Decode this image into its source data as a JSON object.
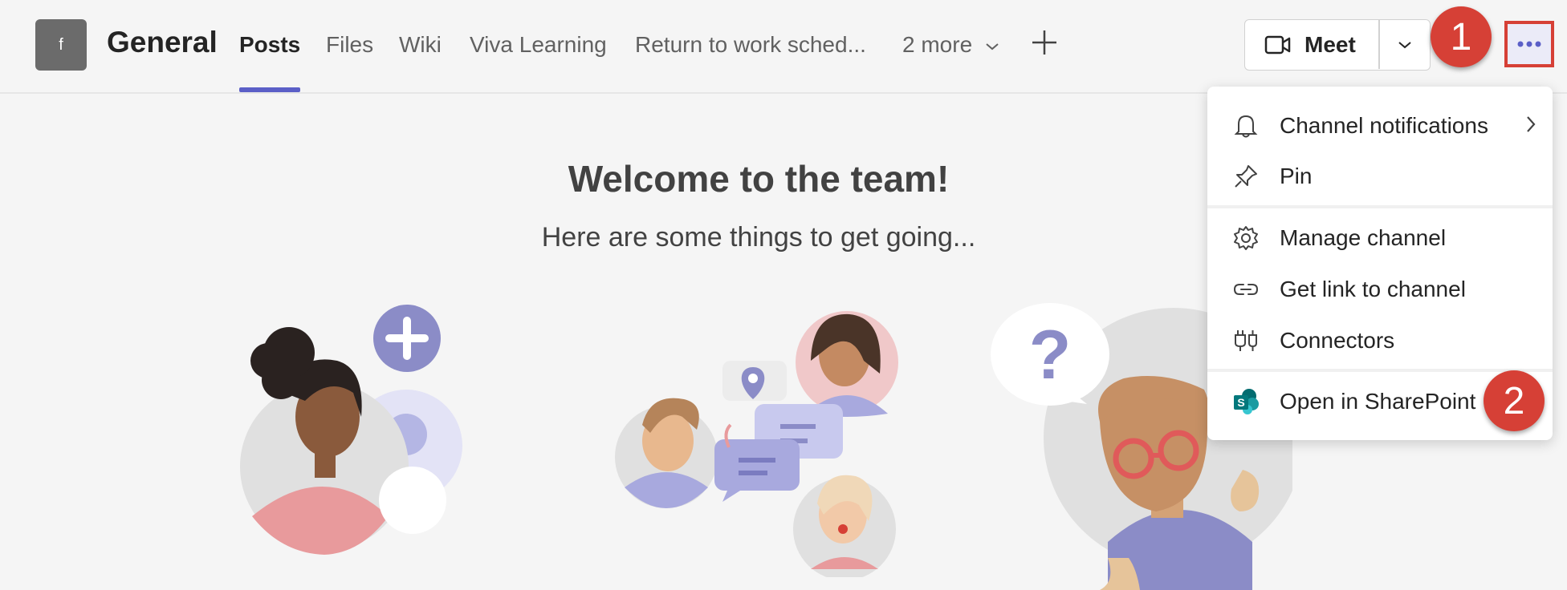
{
  "header": {
    "team_initial": "f",
    "channel_name": "General",
    "tabs": [
      {
        "label": "Posts",
        "active": true
      },
      {
        "label": "Files"
      },
      {
        "label": "Wiki"
      },
      {
        "label": "Viva Learning"
      },
      {
        "label": "Return to work sched..."
      },
      {
        "label": "2 more"
      }
    ],
    "add_tab_icon": "plus-icon",
    "meet": {
      "label": "Meet",
      "icon": "video-camera-icon",
      "dropdown_icon": "chevron-down-icon"
    },
    "more_options_icon": "ellipsis-icon"
  },
  "annotations": {
    "badge_1": "1",
    "badge_2": "2",
    "color": "#d64036"
  },
  "main": {
    "title": "Welcome to the team!",
    "subtitle": "Here are some things to get going..."
  },
  "menu": {
    "items": [
      {
        "label": "Channel notifications",
        "icon": "bell-icon",
        "has_submenu": true
      },
      {
        "label": "Pin",
        "icon": "pin-icon"
      },
      {
        "label": "Manage channel",
        "icon": "gear-icon"
      },
      {
        "label": "Get link to channel",
        "icon": "link-icon"
      },
      {
        "label": "Connectors",
        "icon": "connector-plug-icon"
      },
      {
        "label": "Open in SharePoint",
        "icon": "sharepoint-icon"
      }
    ]
  },
  "colors": {
    "accent": "#5b5fc7",
    "background": "#f5f5f5",
    "annotation_red": "#d64036"
  }
}
